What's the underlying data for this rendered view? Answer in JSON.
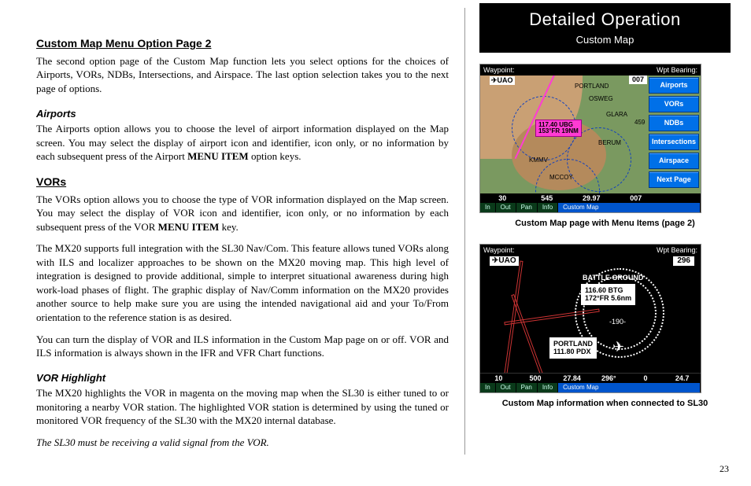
{
  "header": {
    "title": "Detailed Operation",
    "subtitle": "Custom Map"
  },
  "pageNumber": "23",
  "left": {
    "h1": "Custom Map Menu Option Page 2",
    "p1": "The second option page of the Custom Map function lets you select options for the choices of Airports, VORs, NDBs, Intersections, and Airspace. The last option selection takes you to the next page of options.",
    "h2": "Airports",
    "p2a": "The Airports option allows you to choose the level of airport information displayed on the Map screen. You may select the display of airport icon and identifier, icon only, or no information by each subsequent press of the Airport ",
    "p2b": "MENU ITEM",
    "p2c": " option keys.",
    "h3": "VORs",
    "p3a": "The VORs option allows you to choose the type of VOR information displayed on the Map screen. You may select the display of VOR icon and identifier, icon only, or no information by each subsequent press of the VOR ",
    "p3b": "MENU ITEM",
    "p3c": " key.",
    "p4": "The MX20 supports full integration with the SL30 Nav/Com. This feature allows tuned VORs along with ILS and localizer approaches to be shown on the MX20 moving map. This high level of integration is designed to provide additional, simple to interpret situational awareness during high work-load phases of flight. The graphic display of Nav/Comm information on the MX20 provides another source to help make sure you are using the intended navigational aid and your To/From orientation to the reference station is as desired.",
    "p5": "You can turn the display of VOR and ILS information in the Custom Map page on or off. VOR and ILS information is always shown in the IFR and VFR Chart functions.",
    "h4": "VOR Highlight",
    "p6": "The MX20 highlights the VOR in magenta on the moving map when the SL30 is either tuned to or monitoring a nearby VOR station. The highlighted VOR station is determined by using the tuned or monitored VOR frequency of the SL30  with the MX20 internal database.",
    "p7": "The SL30 must be receiving a valid signal from the VOR."
  },
  "fig1": {
    "caption": "Custom Map page with Menu Items (page 2)",
    "topL": "Waypoint:",
    "topR": "Wpt Bearing:",
    "wpt": "✈UAO",
    "wptBearing": "007",
    "buttons": [
      "Airports",
      "VORs",
      "NDBs",
      "Intersections",
      "Airspace",
      "Next Page"
    ],
    "vorBox1": "117.40 UBG",
    "vorBox2": "153°FR 19NM",
    "labels": {
      "a": "PORTLAND",
      "b": "OSWEG",
      "c": "GLARA",
      "d": "BERUM",
      "e": "KMMV",
      "f": "MCCOY",
      "g": "459"
    },
    "btmVals": [
      "30",
      "545",
      "29.97",
      "007"
    ],
    "modes": [
      "In",
      "Out",
      "Pan",
      "Info",
      "Custom Map"
    ]
  },
  "fig2": {
    "caption": "Custom Map information when connected to SL30",
    "topL": "Waypoint:",
    "topR": "Wpt Bearing:",
    "wpt": "✈UAO",
    "wptBearing": "296",
    "city": "BATTLE GROUND",
    "vb1a": "116.60 BTG",
    "vb1b": "172°FR 5.6nm",
    "vb2a": "PORTLAND",
    "vb2b": "111.80 PDX",
    "ringTick": "-190-",
    "btmVals": [
      "10",
      "500",
      "27.84",
      "296°",
      "0",
      "24.7"
    ],
    "modes": [
      "In",
      "Out",
      "Pan",
      "Info",
      "Custom Map"
    ]
  }
}
